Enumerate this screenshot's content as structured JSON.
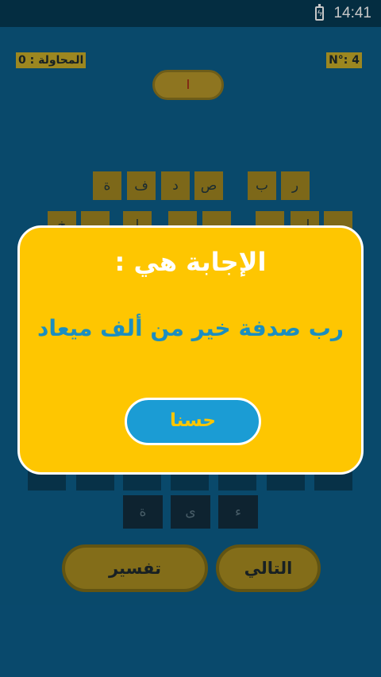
{
  "status_bar": {
    "time": "14:41",
    "battery_icon": "battery-charging-icon"
  },
  "header": {
    "attempts_label": "المحاولة : 0",
    "level_label": "N°: 4",
    "mark_icon": "ا"
  },
  "puzzle": {
    "row1_tiles": [
      "ة",
      "ف",
      "د",
      "ص",
      "ب",
      "ر"
    ],
    "row2_tiles": [
      "خ",
      "ا",
      "ل"
    ]
  },
  "keyboard": {
    "keys": [
      "ة",
      "ى",
      "ء"
    ]
  },
  "buttons": {
    "explain_label": "تفسير",
    "next_label": "التالي"
  },
  "dialog": {
    "title": "الإجابة هي :",
    "answer": "رب صدفة خير من ألف ميعاد",
    "ok_label": "حسنا"
  },
  "colors": {
    "background": "#0c5e8a",
    "dialog_bg": "#fec601",
    "accent_blue": "#1b9cd4"
  }
}
